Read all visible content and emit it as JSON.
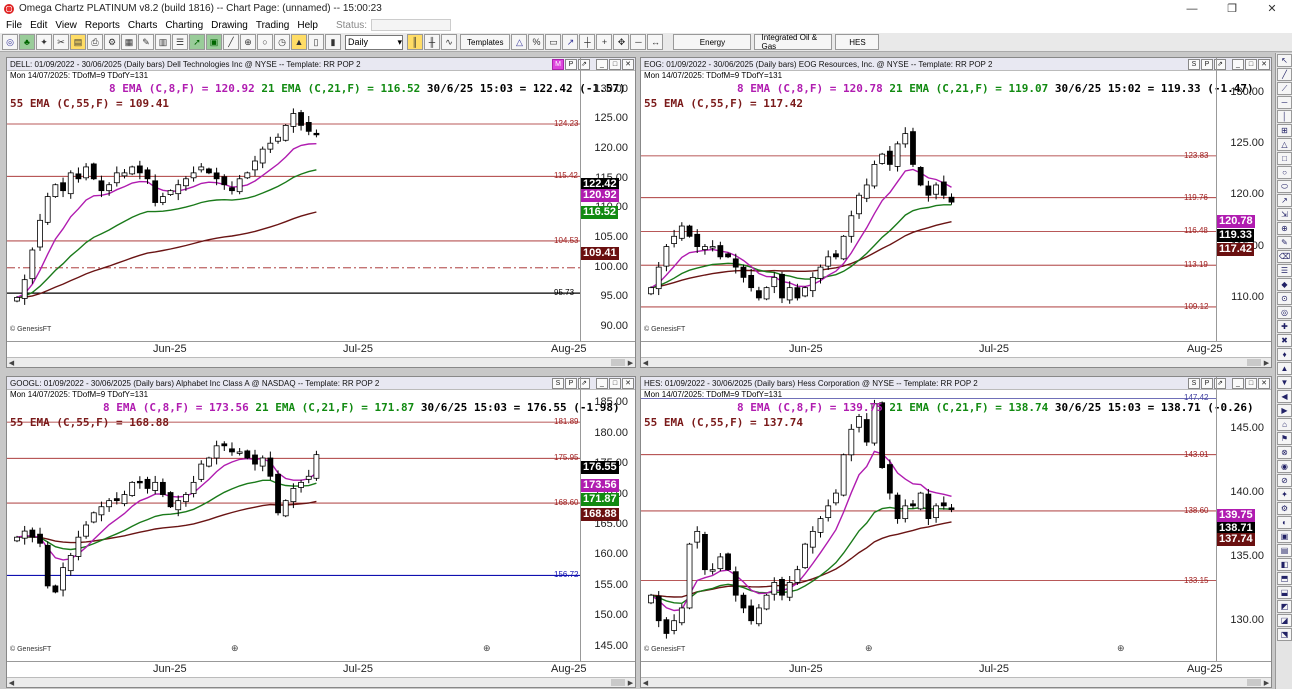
{
  "window": {
    "title": "Omega Chartz PLATINUM v8.2 (build 1816)  --  Chart Page: (unnamed)  --  15:00:23"
  },
  "menu": [
    "File",
    "Edit",
    "View",
    "Reports",
    "Charts",
    "Charting",
    "Drawing",
    "Trading",
    "Help"
  ],
  "status_label": "Status:",
  "toolbar": {
    "period_select": "Daily",
    "templates_label": "Templates",
    "pages": [
      "Energy",
      "Integrated Oil & Gas",
      "HES"
    ]
  },
  "credit": "© GenesisFT",
  "panels": [
    {
      "header": "DELL: 01/09/2022 - 30/06/2025 (Daily bars)  Dell Technologies Inc @ NYSE  --  Template: RR POP 2",
      "date_line": "Mon  14/07/2025:  TDofM=9  TDofY=131",
      "ema8": "8 EMA (C,8,F) = 120.92",
      "ema21": "21 EMA (C,21,F) = 116.52",
      "last": "30/6/25 15:03 = 122.42 (-1.57)",
      "ema55": "55 EMA (C,55,F) = 109.41",
      "y_ticks": [
        "130.00",
        "125.00",
        "120.00",
        "115.00",
        "110.00",
        "105.00",
        "100.00",
        "95.00",
        "90.00"
      ],
      "x_labels": [
        "Jun-25",
        "Jul-25",
        "Aug-25"
      ],
      "hlines": [
        "124.23",
        "115.42",
        "104.53",
        "95.73"
      ],
      "tags": [
        {
          "v": "122.42",
          "bg": "#000000"
        },
        {
          "v": "120.92",
          "bg": "#b01cb0"
        },
        {
          "v": "116.52",
          "bg": "#118a11"
        },
        {
          "v": "109.41",
          "bg": "#6a1010"
        }
      ],
      "m_button": true
    },
    {
      "header": "EOG: 01/09/2022 - 30/06/2025 (Daily bars)  EOG Resources, Inc. @ NYSE  --  Template: RR POP 2",
      "date_line": "Mon  14/07/2025:  TDofM=9  TDofY=131",
      "ema8": "8 EMA (C,8,F) = 120.78",
      "ema21": "21 EMA (C,21,F) = 119.07",
      "last": "30/6/25 15:02 = 119.33 (-1.47)",
      "ema55": "55 EMA (C,55,F) = 117.42",
      "y_ticks": [
        "130.00",
        "125.00",
        "120.00",
        "115.00",
        "110.00"
      ],
      "x_labels": [
        "Jun-25",
        "Jul-25",
        "Aug-25"
      ],
      "hlines": [
        "123.83",
        "119.76",
        "116.48",
        "113.19",
        "109.12"
      ],
      "tags": [
        {
          "v": "120.78",
          "bg": "#b01cb0"
        },
        {
          "v": "119.33",
          "bg": "#000000"
        },
        {
          "v": "117.42",
          "bg": "#6a1010"
        }
      ],
      "m_button": false
    },
    {
      "header": "GOOGL: 01/09/2022 - 30/06/2025 (Daily bars)  Alphabet Inc Class A @ NASDAQ  --  Template: RR POP 2",
      "date_line": "Mon  14/07/2025:  TDofM=9  TDofY=131",
      "ema8": "8 EMA (C,8,F) = 173.56",
      "ema21": "21 EMA (C,21,F) = 171.87",
      "last": "30/6/25 15:03 = 176.55 (-1.98)",
      "ema55": "55 EMA (C,55,F) = 168.88",
      "y_ticks": [
        "185.00",
        "180.00",
        "175.00",
        "170.00",
        "165.00",
        "160.00",
        "155.00",
        "150.00",
        "145.00"
      ],
      "x_labels": [
        "Jun-25",
        "Jul-25",
        "Aug-25"
      ],
      "hlines": [
        "181.89",
        "175.95",
        "168.60",
        "156.72"
      ],
      "tags": [
        {
          "v": "176.55",
          "bg": "#000000"
        },
        {
          "v": "173.56",
          "bg": "#b01cb0"
        },
        {
          "v": "171.87",
          "bg": "#118a11"
        },
        {
          "v": "168.88",
          "bg": "#6a1010"
        }
      ],
      "m_button": false
    },
    {
      "header": "HES: 01/09/2022 - 30/06/2025 (Daily bars)  Hess Corporation @ NYSE  --  Template: RR POP 2",
      "date_line": "Mon  14/07/2025:  TDofM=9  TDofY=131",
      "ema8": "8 EMA (C,8,F) = 139.75",
      "ema21": "21 EMA (C,21,F) = 138.74",
      "last": "30/6/25 15:03 = 138.71 (-0.26)",
      "ema55": "55 EMA (C,55,F) = 137.74",
      "y_ticks": [
        "145.00",
        "140.00",
        "135.00",
        "130.00"
      ],
      "x_labels": [
        "Jun-25",
        "Jul-25",
        "Aug-25"
      ],
      "hlines": [
        "147.42",
        "143.01",
        "138.60",
        "133.15"
      ],
      "tags": [
        {
          "v": "139.75",
          "bg": "#b01cb0"
        },
        {
          "v": "138.71",
          "bg": "#000000"
        },
        {
          "v": "137.74",
          "bg": "#6a1010"
        }
      ],
      "m_button": false
    }
  ],
  "chart_data": [
    {
      "type": "candlestick",
      "symbol": "DELL",
      "ylim": [
        88,
        133
      ],
      "closes": [
        95,
        98,
        103,
        108,
        112,
        114,
        113,
        116,
        115,
        117,
        115,
        113,
        114,
        116,
        116,
        117,
        116,
        115,
        111,
        112,
        113,
        114,
        115,
        116,
        117,
        116,
        115,
        114,
        113,
        115,
        116,
        118,
        120,
        121,
        122,
        124,
        126,
        124,
        123,
        122.42
      ],
      "ema8_end": 120.92,
      "ema21_end": 116.52,
      "ema55_end": 109.41,
      "hlines": [
        {
          "v": 124.23,
          "color": "#a02020"
        },
        {
          "v": 115.42,
          "color": "#a02020"
        },
        {
          "v": 104.53,
          "color": "#a02020"
        },
        {
          "v": 100.0,
          "color": "#a02020",
          "dash": true
        },
        {
          "v": 95.73,
          "color": "#000000"
        }
      ]
    },
    {
      "type": "candlestick",
      "symbol": "EOG",
      "ylim": [
        106,
        132
      ],
      "closes": [
        111,
        113,
        115,
        116,
        117,
        116,
        115,
        115,
        115,
        114,
        114,
        113,
        112,
        111,
        110,
        111,
        112,
        110,
        111,
        110,
        111,
        112,
        113,
        114,
        114,
        116,
        118,
        120,
        121,
        123,
        124,
        123,
        125,
        126,
        123,
        121,
        120,
        121,
        120,
        119.33
      ],
      "ema8_end": 120.78,
      "ema21_end": 119.07,
      "ema55_end": 117.42,
      "hlines": [
        {
          "v": 123.83,
          "color": "#a02020"
        },
        {
          "v": 119.76,
          "color": "#a02020"
        },
        {
          "v": 116.48,
          "color": "#a02020"
        },
        {
          "v": 113.19,
          "color": "#a02020"
        },
        {
          "v": 109.12,
          "color": "#a02020"
        }
      ]
    },
    {
      "type": "candlestick",
      "symbol": "GOOGL",
      "ylim": [
        143,
        187
      ],
      "closes": [
        163,
        164,
        163,
        162,
        155,
        154,
        158,
        160,
        163,
        165,
        167,
        168,
        169,
        169,
        170,
        172,
        172,
        171,
        172,
        170,
        168,
        169,
        170,
        172,
        175,
        176,
        178,
        178,
        177,
        177,
        176,
        175,
        176,
        173,
        167,
        169,
        171,
        172,
        173,
        176.55
      ],
      "ema8_end": 173.56,
      "ema21_end": 171.87,
      "ema55_end": 168.88,
      "hlines": [
        {
          "v": 181.89,
          "color": "#a02020"
        },
        {
          "v": 175.95,
          "color": "#a02020"
        },
        {
          "v": 168.6,
          "color": "#a02020"
        },
        {
          "v": 156.72,
          "color": "#1010b0"
        }
      ]
    },
    {
      "type": "candlestick",
      "symbol": "HES",
      "ylim": [
        127,
        148
      ],
      "closes": [
        132,
        130,
        129,
        130,
        131,
        136,
        137,
        134,
        134,
        135,
        134,
        132,
        131,
        130,
        131,
        132,
        133,
        132,
        133,
        134,
        136,
        137,
        138,
        139,
        140,
        143,
        145,
        146,
        144,
        147,
        142,
        140,
        138,
        139,
        139,
        140,
        138,
        139,
        139,
        138.71
      ],
      "ema8_end": 139.75,
      "ema21_end": 138.74,
      "ema55_end": 137.74,
      "hlines": [
        {
          "v": 147.42,
          "color": "#4040a0"
        },
        {
          "v": 143.01,
          "color": "#a02020"
        },
        {
          "v": 138.6,
          "color": "#a02020"
        },
        {
          "v": 133.15,
          "color": "#a02020"
        }
      ]
    }
  ]
}
